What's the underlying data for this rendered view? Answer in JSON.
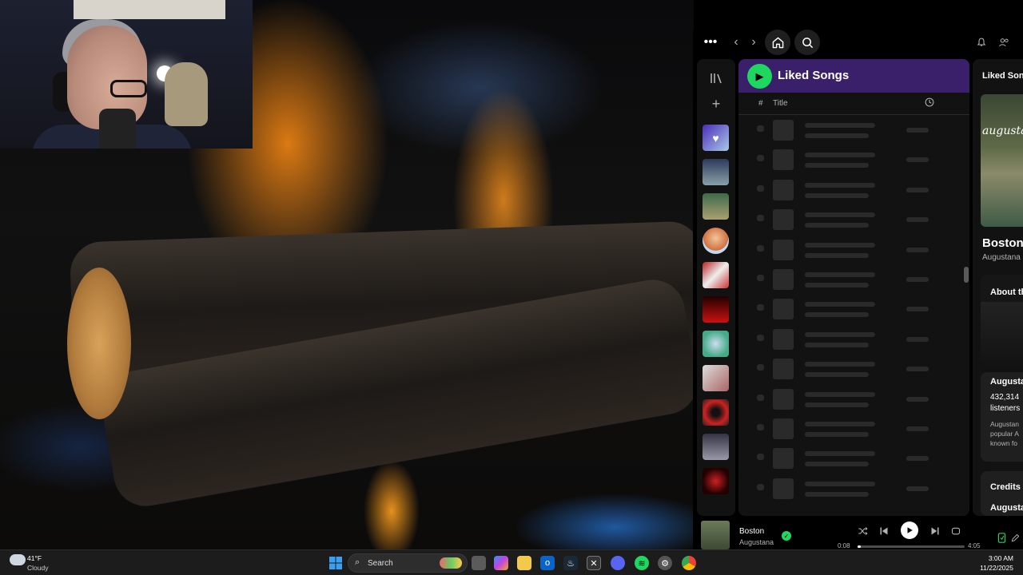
{
  "wallpaper": {
    "name": "fireplace"
  },
  "spotify": {
    "topbar": {
      "menu_icon": "more-dots-icon",
      "back_icon": "chevron-left-icon",
      "forward_icon": "chevron-right-icon",
      "home_icon": "home-icon",
      "search_icon": "search-icon",
      "bell_icon": "bell-icon",
      "friends_icon": "friends-icon"
    },
    "library": {
      "collapse_icon": "library-icon",
      "add_icon": "plus-icon",
      "items": [
        "Liked Songs",
        "playlist",
        "playlist",
        "artist",
        "playlist",
        "playlist",
        "playlist",
        "playlist",
        "playlist",
        "playlist",
        "playlist"
      ]
    },
    "main": {
      "title": "Liked Songs",
      "col_number": "#",
      "col_title": "Title",
      "col_duration_icon": "clock-icon",
      "loading_rows": 13
    },
    "right_panel": {
      "heading": "Liked Songs",
      "album_caption": "augustana",
      "track_title": "Boston",
      "track_artist": "Augustana",
      "about_heading": "About th",
      "artist_name": "Augusta",
      "listeners_count": "432,314",
      "listeners_label": "listeners",
      "bio_line1": "Augustan",
      "bio_line2": "popular A",
      "bio_line3": "known fo",
      "credits_heading": "Credits",
      "credits_artist": "Augusta"
    },
    "player": {
      "track": "Boston",
      "artist": "Augustana",
      "elapsed": "0:08",
      "duration": "4:05",
      "progress_fraction": 0.033,
      "accent": "#1ed760"
    }
  },
  "taskbar": {
    "weather_temp": "41°F",
    "weather_desc": "Cloudy",
    "search_label": "Search",
    "time": "3:00 AM",
    "date": "11/22/2025"
  }
}
